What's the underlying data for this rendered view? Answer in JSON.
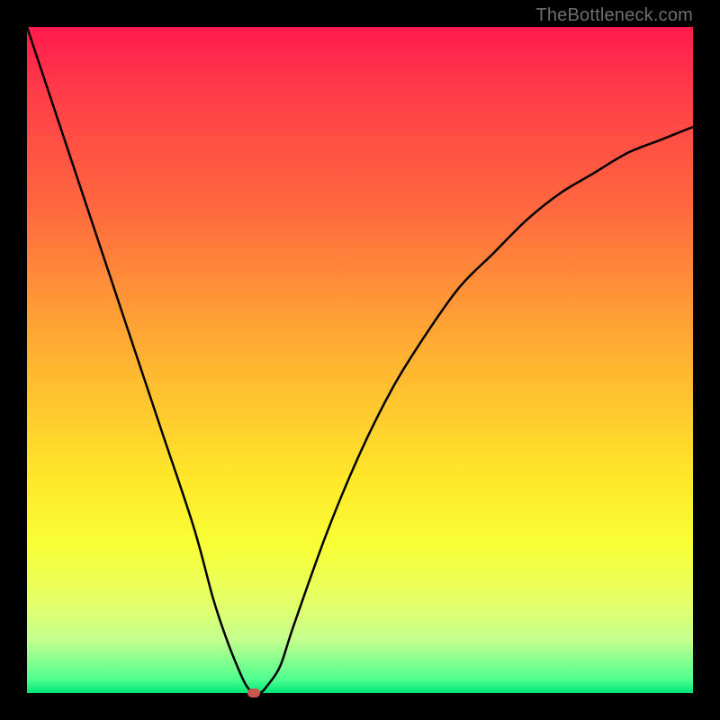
{
  "watermark": "TheBottleneck.com",
  "chart_data": {
    "type": "line",
    "title": "",
    "xlabel": "",
    "ylabel": "",
    "xlim": [
      0,
      100
    ],
    "ylim": [
      0,
      100
    ],
    "grid": false,
    "series": [
      {
        "name": "bottleneck-curve",
        "x": [
          0,
          5,
          10,
          15,
          20,
          25,
          28,
          30,
          32,
          33,
          34,
          35,
          36,
          38,
          40,
          45,
          50,
          55,
          60,
          65,
          70,
          75,
          80,
          85,
          90,
          95,
          100
        ],
        "values": [
          100,
          85,
          70,
          55,
          40,
          25,
          14,
          8,
          3,
          1,
          0,
          0,
          1,
          4,
          10,
          24,
          36,
          46,
          54,
          61,
          66,
          71,
          75,
          78,
          81,
          83,
          85
        ]
      }
    ],
    "marker": {
      "name": "optimal-point",
      "x": 34,
      "y": 0,
      "color": "#c9564f"
    },
    "background_gradient": {
      "top": "#ff1a4e",
      "mid": "#ffe82a",
      "bottom": "#00e676"
    }
  }
}
